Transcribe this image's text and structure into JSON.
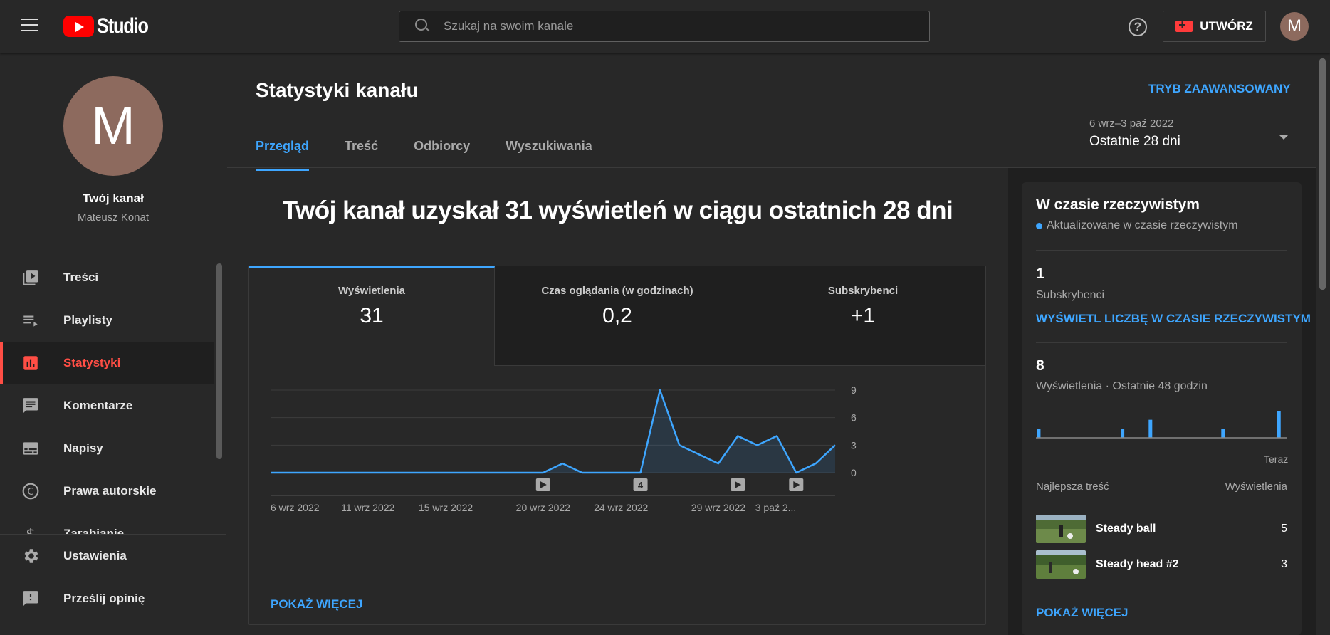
{
  "topbar": {
    "logo_text": "Studio",
    "search_placeholder": "Szukaj na swoim kanale",
    "create_label": "UTWÓRZ",
    "avatar_letter": "M"
  },
  "sidebar": {
    "avatar_letter": "M",
    "channel_title": "Twój kanał",
    "channel_user": "Mateusz Konat",
    "items": [
      {
        "label": "Treści",
        "icon": "video-library-icon"
      },
      {
        "label": "Playlisty",
        "icon": "playlist-icon"
      },
      {
        "label": "Statystyki",
        "icon": "analytics-icon",
        "active": true
      },
      {
        "label": "Komentarze",
        "icon": "comments-icon"
      },
      {
        "label": "Napisy",
        "icon": "subtitles-icon"
      },
      {
        "label": "Prawa autorskie",
        "icon": "copyright-icon"
      },
      {
        "label": "Zarabianie",
        "icon": "dollar-icon"
      }
    ],
    "bottom_items": [
      {
        "label": "Ustawienia",
        "icon": "gear-icon"
      },
      {
        "label": "Prześlij opinię",
        "icon": "feedback-icon"
      }
    ]
  },
  "main": {
    "title": "Statystyki kanału",
    "advanced_link": "TRYB ZAAWANSOWANY",
    "tabs": [
      {
        "label": "Przegląd",
        "active": true
      },
      {
        "label": "Treść"
      },
      {
        "label": "Odbiorcy"
      },
      {
        "label": "Wyszukiwania"
      }
    ],
    "date_range_dates": "6 wrz–3 paź 2022",
    "date_range_label": "Ostatnie 28 dni",
    "headline": "Twój kanał uzyskał 31 wyświetleń w ciągu ostatnich 28 dni",
    "metrics": [
      {
        "label": "Wyświetlenia",
        "value": "31",
        "active": true
      },
      {
        "label": "Czas oglądania (w godzinach)",
        "value": "0,2"
      },
      {
        "label": "Subskrybenci",
        "value": "+1"
      }
    ],
    "show_more": "POKAŻ WIĘCEJ"
  },
  "chart_data": {
    "type": "area",
    "x": [
      "6 wrz 2022",
      "7 wrz",
      "8 wrz",
      "9 wrz",
      "10 wrz",
      "11 wrz 2022",
      "12 wrz",
      "13 wrz",
      "14 wrz",
      "15 wrz 2022",
      "16 wrz",
      "17 wrz",
      "18 wrz",
      "19 wrz",
      "20 wrz 2022",
      "21 wrz",
      "22 wrz",
      "23 wrz",
      "24 wrz 2022",
      "25 wrz",
      "26 wrz",
      "27 wrz",
      "28 wrz",
      "29 wrz 2022",
      "30 wrz",
      "1 paź",
      "2 paź",
      "3 paź 2022"
    ],
    "series": [
      {
        "values": [
          0,
          0,
          0,
          0,
          0,
          0,
          0,
          0,
          0,
          0,
          0,
          0,
          0,
          0,
          0,
          1,
          0,
          0,
          0,
          0,
          9,
          3,
          2,
          1,
          4,
          3,
          4,
          0,
          1,
          3
        ]
      }
    ],
    "xtick_labels": [
      "6 wrz 2022",
      "11 wrz 2022",
      "15 wrz 2022",
      "20 wrz 2022",
      "24 wrz 2022",
      "29 wrz 2022",
      "3 paź 2..."
    ],
    "xtick_index": [
      0,
      5,
      9,
      14,
      18,
      23,
      27
    ],
    "yticks": [
      "0",
      "3",
      "6",
      "9"
    ],
    "ylim": [
      0,
      9
    ],
    "markers": [
      {
        "index": 14,
        "label": "",
        "kind": "video"
      },
      {
        "index": 19,
        "label": "4",
        "kind": "count"
      },
      {
        "index": 24,
        "label": "",
        "kind": "video"
      },
      {
        "index": 27,
        "label": "",
        "kind": "video"
      }
    ],
    "color": "#3ea6ff"
  },
  "realtime": {
    "title": "W czasie rzeczywistym",
    "subtitle": "Aktualizowane w czasie rzeczywistym",
    "subs_value": "1",
    "subs_label": "Subskrybenci",
    "subs_link": "WYŚWIETL LICZBĘ W CZASIE RZECZYWISTYM",
    "views_value": "8",
    "views_label": "Wyświetlenia · Ostatnie 48 godzin",
    "bars": [
      1,
      0,
      0,
      0,
      0,
      0,
      0,
      0,
      0,
      0,
      0,
      0,
      0,
      0,
      0,
      1,
      0,
      0,
      0,
      0,
      2,
      0,
      0,
      0,
      0,
      0,
      0,
      0,
      0,
      0,
      0,
      0,
      0,
      1,
      0,
      0,
      0,
      0,
      0,
      0,
      0,
      0,
      0,
      3,
      0
    ],
    "now_label": "Teraz",
    "top_head_left": "Najlepsza treść",
    "top_head_right": "Wyświetlenia",
    "top_content": [
      {
        "title": "Steady ball",
        "views": "5"
      },
      {
        "title": "Steady head #2",
        "views": "3"
      }
    ],
    "show_more": "POKAŻ WIĘCEJ"
  }
}
